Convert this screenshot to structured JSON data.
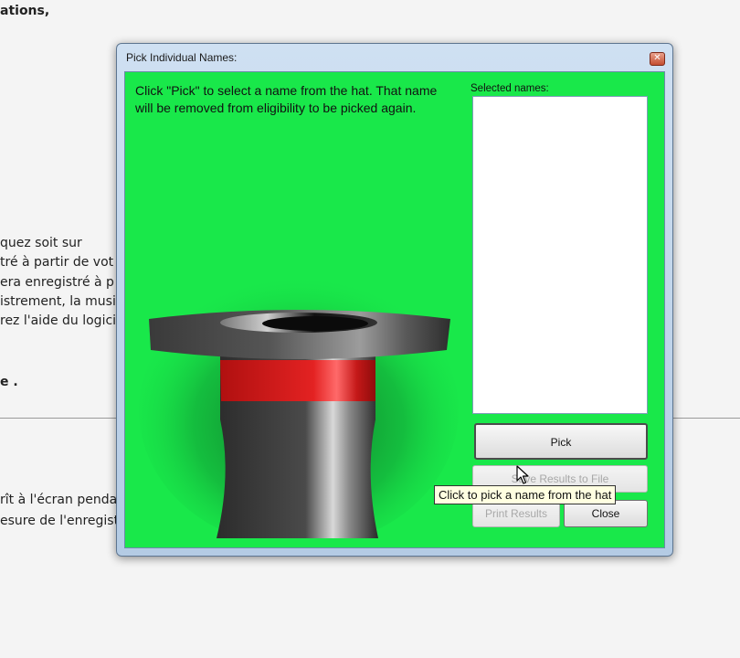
{
  "background_doc": {
    "line1": "ations,",
    "line2": "quez soit sur",
    "line3": "tré à partir de vot",
    "line4": "era enregistré à p",
    "line5": "istrement, la musi",
    "line6": "rez l'aide du logici",
    "line7": "e .",
    "line8": "rît à l'écran pendar",
    "line9": "esure de l'enregist"
  },
  "dialog": {
    "title": "Pick Individual Names:",
    "close_glyph": "✕",
    "instructions": "Click \"Pick\" to select a name from the hat. That name will be removed from eligibility to be picked again.",
    "selected_label": "Selected names:",
    "selected_items": [],
    "buttons": {
      "pick": "Pick",
      "save": "Save Results to File",
      "print": "Print Results",
      "close": "Close"
    },
    "tooltip": "Click to pick a name from the hat",
    "client_color": "#19e84a"
  },
  "icons": {
    "hat": "top-hat-icon",
    "cursor": "mouse-pointer-icon"
  }
}
